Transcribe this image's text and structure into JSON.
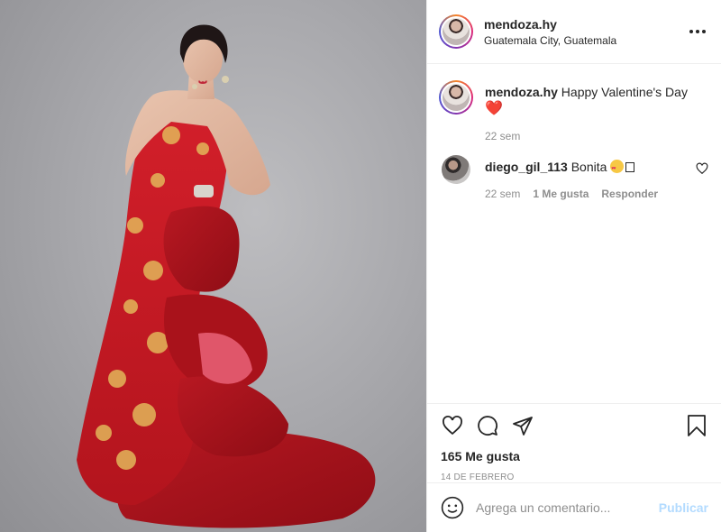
{
  "post": {
    "username": "mendoza.hy",
    "location": "Guatemala City, Guatemala"
  },
  "caption": {
    "username": "mendoza.hy",
    "text": "Happy Valentine's Day",
    "emoji": "❤️",
    "time": "22 sem"
  },
  "comments": [
    {
      "username": "diego_gil_113",
      "text": "Bonita",
      "time": "22 sem",
      "likes": "1 Me gusta",
      "reply": "Responder"
    }
  ],
  "actions": {
    "likes": "165 Me gusta",
    "date": "14 de febrero"
  },
  "add_comment": {
    "placeholder": "Agrega un comentario...",
    "post_label": "Publicar"
  },
  "icons": [
    "more-icon",
    "heart-icon",
    "comment-icon",
    "share-icon",
    "bookmark-icon",
    "emoji-icon"
  ],
  "colors": {
    "accent_disabled": "#b3dbff",
    "muted": "#8e8e8e",
    "text": "#262626"
  }
}
